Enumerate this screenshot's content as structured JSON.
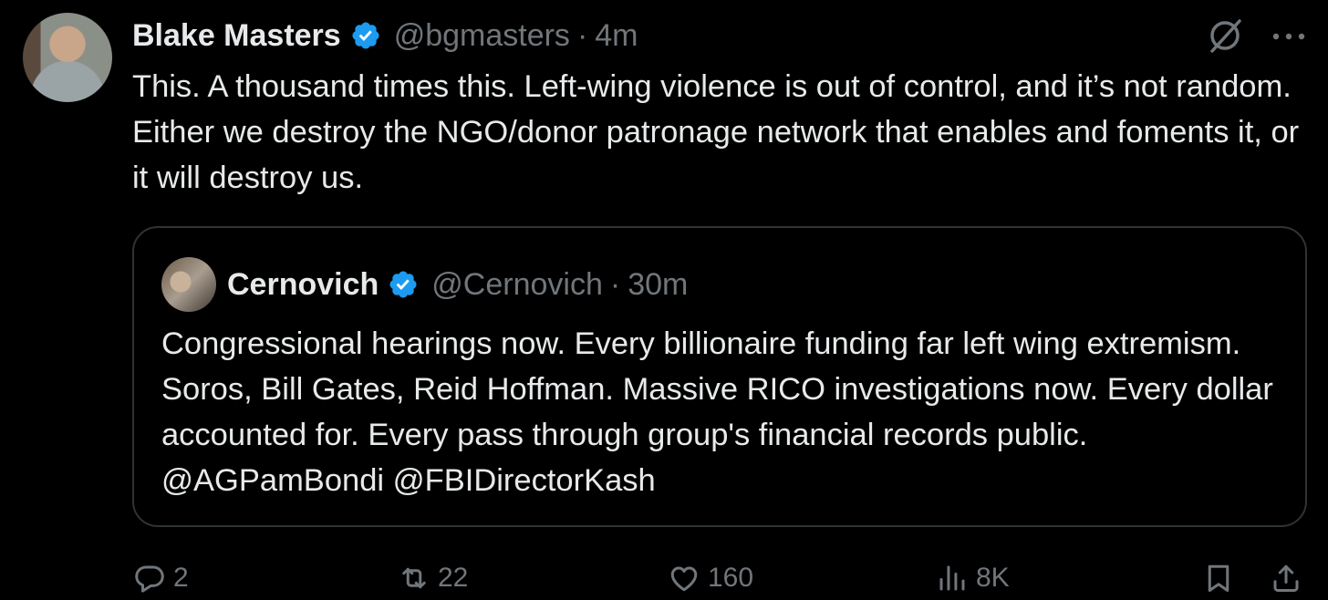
{
  "author": {
    "display_name": "Blake Masters",
    "handle": "@bgmasters",
    "separator": "·",
    "time": "4m",
    "verified": true,
    "avatar_icon": "user-avatar"
  },
  "tweet_text": "This. A thousand times this. Left-wing violence is out of control, and it’s not random. Either we destroy the NGO/donor patronage network that enables and foments it, or it will destroy us.",
  "quoted": {
    "display_name": "Cernovich",
    "handle": "@Cernovich",
    "separator": "·",
    "time": "30m",
    "verified": true,
    "text": "Congressional hearings now. Every billionaire funding far left wing extremism. Soros, Bill Gates, Reid Hoffman. Massive RICO investigations now. Every dollar accounted for. Every pass through group's financial records public.  @AGPamBondi @FBIDirectorKash"
  },
  "actions": {
    "replies": "2",
    "reposts": "22",
    "likes": "160",
    "views": "8K"
  },
  "colors": {
    "background": "#000000",
    "text": "#e7e9ea",
    "muted": "#71767b",
    "border": "#2f3336",
    "verified": "#1d9bf0"
  }
}
